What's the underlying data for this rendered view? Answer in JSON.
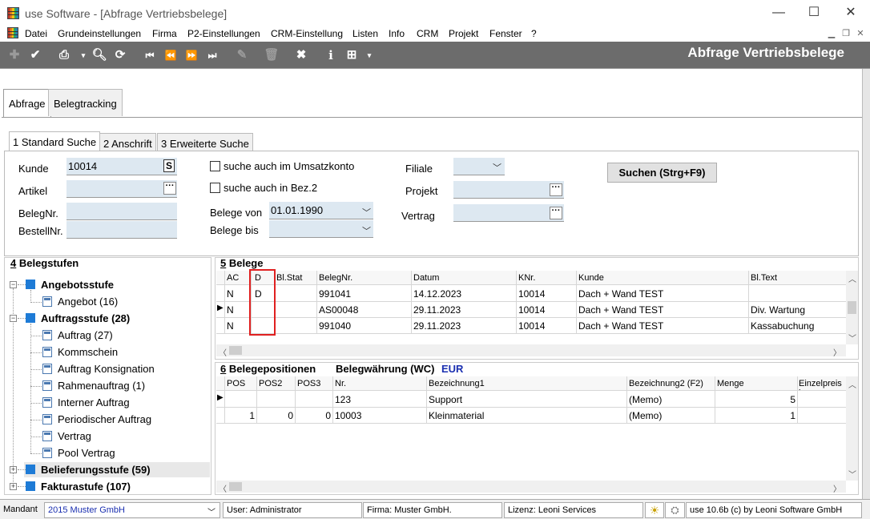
{
  "window": {
    "title": "use Software - [Abfrage Vertriebsbelege]",
    "minimize": "—",
    "maximize": "☐",
    "close": "✕"
  },
  "menu": {
    "items": [
      "Datei",
      "Grundeinstellungen",
      "Firma",
      "P2-Einstellungen",
      "CRM-Einstellung",
      "Listen",
      "Info",
      "CRM",
      "Projekt",
      "Fenster",
      "?"
    ]
  },
  "toolbar": {
    "title": "Abfrage Vertriebsbelege",
    "icons": [
      "add-icon",
      "check-icon",
      "print-icon",
      "search-icon",
      "refresh-icon",
      "first-icon",
      "prev-icon",
      "next-icon",
      "last-icon",
      "edit-icon",
      "delete-icon",
      "cancel-icon",
      "info-icon",
      "grid-icon"
    ]
  },
  "tabs": {
    "main": [
      "Abfrage",
      "Belegtracking"
    ],
    "search": [
      "1 Standard Suche",
      "2 Anschrift",
      "3 Erweiterte Suche"
    ]
  },
  "search": {
    "kunde_label": "Kunde",
    "kunde_value": "10014",
    "kunde_btn": "S",
    "artikel_label": "Artikel",
    "belegnr_label": "BelegNr.",
    "bestellnr_label": "BestellNr.",
    "umsatz_label": "suche auch im Umsatzkonto",
    "bez2_label": "suche auch in Bez.2",
    "belege_von_label": "Belege von",
    "belege_von_value": "01.01.1990",
    "belege_bis_label": "Belege bis",
    "filiale_label": "Filiale",
    "projekt_label": "Projekt",
    "vertrag_label": "Vertrag",
    "suchen_btn": "Suchen (Strg+F9)",
    "ellipsis": "···"
  },
  "belegstufen": {
    "header_num": "4",
    "header_text": " Belegstufen",
    "nodes": [
      {
        "label": "Angebotsstufe",
        "level": 0
      },
      {
        "label": "Angebot (16)",
        "level": 1
      },
      {
        "label": "Auftragsstufe (28)",
        "level": 0
      },
      {
        "label": "Auftrag (27)",
        "level": 1
      },
      {
        "label": "Kommschein",
        "level": 1
      },
      {
        "label": "Auftrag Konsignation",
        "level": 1
      },
      {
        "label": "Rahmenauftrag (1)",
        "level": 1
      },
      {
        "label": "Interner Auftrag",
        "level": 1
      },
      {
        "label": "Periodischer Auftrag",
        "level": 1
      },
      {
        "label": "Vertrag",
        "level": 1
      },
      {
        "label": "Pool Vertrag",
        "level": 1
      },
      {
        "label": "Belieferungsstufe (59)",
        "level": 0
      },
      {
        "label": "Fakturastufe (107)",
        "level": 0
      }
    ]
  },
  "belege": {
    "header_num": "5",
    "header_text": " Belege",
    "columns": [
      "AC",
      "D",
      "Bl.Stat",
      "BelegNr.",
      "Datum",
      "KNr.",
      "Kunde",
      "Bl.Text"
    ],
    "rows": [
      {
        "ac": "N",
        "d": "D",
        "stat": "",
        "nr": "991041",
        "datum": "14.12.2023",
        "knr": "10014",
        "kunde": "Dach + Wand TEST",
        "text": ""
      },
      {
        "ac": "N",
        "d": "",
        "stat": "",
        "nr": "AS00048",
        "datum": "29.11.2023",
        "knr": "10014",
        "kunde": "Dach + Wand TEST",
        "text": "Div. Wartung"
      },
      {
        "ac": "N",
        "d": "",
        "stat": "",
        "nr": "991040",
        "datum": "29.11.2023",
        "knr": "10014",
        "kunde": "Dach + Wand TEST",
        "text": "Kassabuchung"
      }
    ]
  },
  "positionen": {
    "header_num": "6",
    "header_text": " Belegepositionen",
    "waehrung_label": "Belegwährung (WC)",
    "waehrung_value": "EUR",
    "columns": [
      "POS",
      "POS2",
      "POS3",
      "Nr.",
      "Bezeichnung1",
      "Bezeichnung2 (F2)",
      "Menge",
      "Einzelpreis in"
    ],
    "rows": [
      {
        "pos": "",
        "pos2": "",
        "pos3": "",
        "nr": "123",
        "bez1": "Support",
        "bez2": "(Memo)",
        "menge": "5"
      },
      {
        "pos": "1",
        "pos2": "0",
        "pos3": "0",
        "nr": "10003",
        "bez1": "Kleinmaterial",
        "bez2": "(Memo)",
        "menge": "1"
      }
    ]
  },
  "status": {
    "mandant_label": "Mandant",
    "mandant_value": "2015 Muster GmbH",
    "user": "User: Administrator",
    "firma": "Firma: Muster GmbH.",
    "lizenz": "Lizenz: Leoni Services",
    "version": "use 10.6b (c) by Leoni Software GmbH"
  },
  "colors": {
    "toolbar": "#6c6c6c",
    "field": "#dde8f1",
    "tree_square": "#1e7bd6",
    "highlight_box": "#e02020",
    "currency": "#1a2fb0"
  }
}
